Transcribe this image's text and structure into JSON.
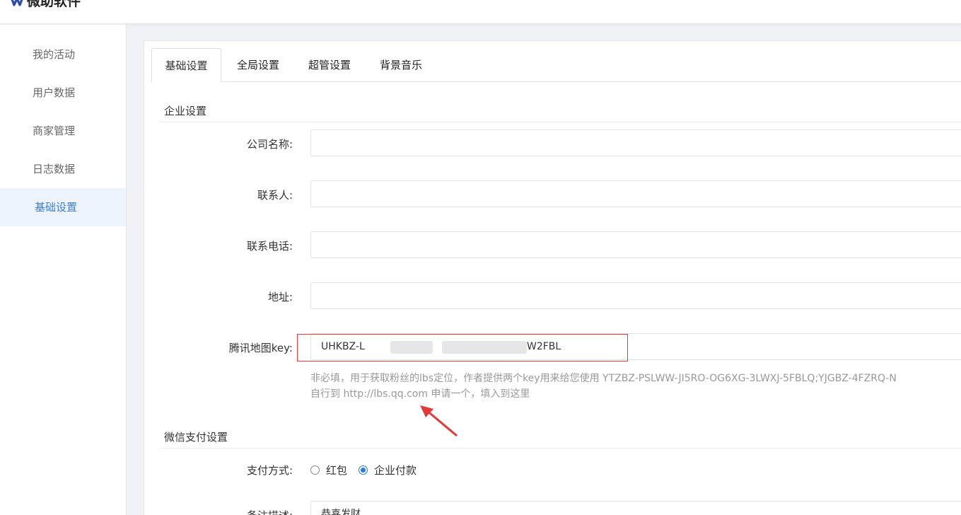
{
  "app": {
    "logo_text": "微助软件"
  },
  "sidebar": {
    "items": [
      {
        "label": "我的活动"
      },
      {
        "label": "用户数据"
      },
      {
        "label": "商家管理"
      },
      {
        "label": "日志数据"
      },
      {
        "label": "基础设置"
      }
    ],
    "active_index": 4
  },
  "tabs": [
    {
      "label": "基础设置"
    },
    {
      "label": "全局设置"
    },
    {
      "label": "超管设置"
    },
    {
      "label": "背景音乐"
    }
  ],
  "sections": {
    "company": {
      "title": "企业设置",
      "fields": {
        "company_name": {
          "label": "公司名称:",
          "value": ""
        },
        "contact": {
          "label": "联系人:",
          "value": ""
        },
        "phone": {
          "label": "联系电话:",
          "value": ""
        },
        "address": {
          "label": "地址:",
          "value": ""
        },
        "map_key": {
          "label": "腾讯地图key:",
          "value_start": "UHKBZ-L",
          "value_end": "W2FBL"
        }
      },
      "hint_line1": "非必填，用于获取粉丝的lbs定位，作者提供两个key用来给您使用 YTZBZ-PSLWW-JI5RO-OG6XG-3LWXJ-5FBLQ;YJGBZ-4FZRQ-N",
      "hint_line2": "自行到 http://lbs.qq.com 申请一个，填入到这里"
    },
    "wechat_pay": {
      "title": "微信支付设置",
      "pay_method_label": "支付方式:",
      "options": [
        {
          "label": "红包",
          "checked": false
        },
        {
          "label": "企业付款",
          "checked": true
        }
      ],
      "note_label": "备注描述:",
      "note_value": "恭喜发财"
    }
  },
  "colors": {
    "accent": "#3b7fd4",
    "highlight": "#e03a3a",
    "radio_checked": "#2a7be0"
  }
}
